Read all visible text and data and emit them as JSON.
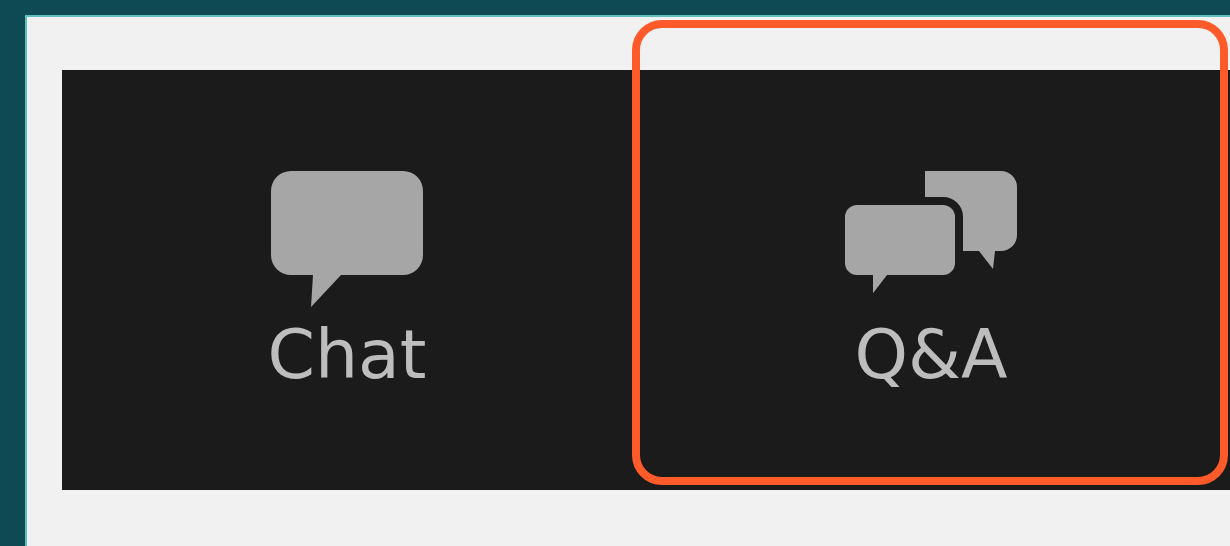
{
  "toolbar": {
    "buttons": [
      {
        "label": "Chat",
        "kind": "chat",
        "highlighted": false
      },
      {
        "label": "Q&A",
        "kind": "qa",
        "highlighted": true
      }
    ]
  }
}
